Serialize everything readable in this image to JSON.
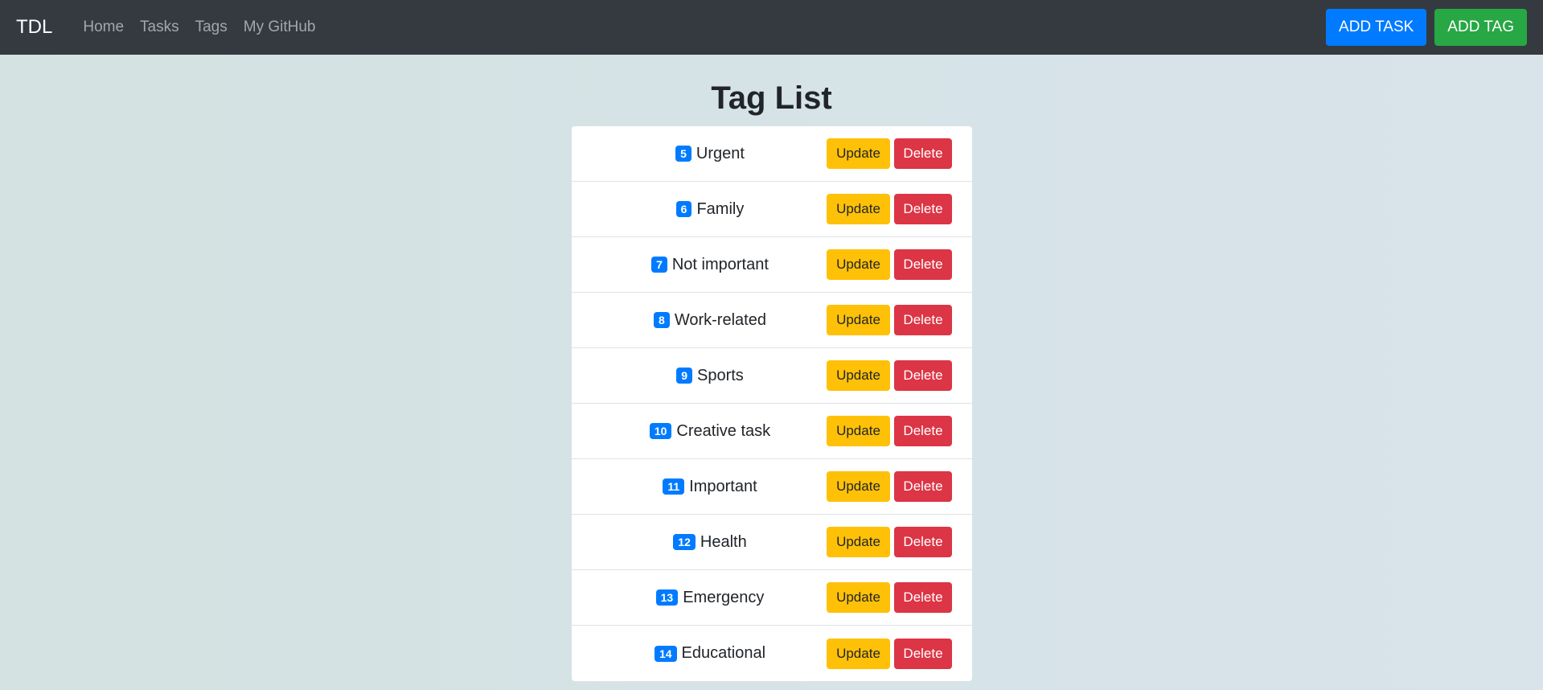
{
  "navbar": {
    "brand": "TDL",
    "links": [
      {
        "label": "Home"
      },
      {
        "label": "Tasks"
      },
      {
        "label": "Tags"
      },
      {
        "label": "My GitHub"
      }
    ],
    "add_task_label": "ADD TASK",
    "add_tag_label": "ADD TAG"
  },
  "main": {
    "title": "Tag List",
    "tags": [
      {
        "id": "5",
        "name": "Urgent",
        "update_label": "Update",
        "delete_label": "Delete"
      },
      {
        "id": "6",
        "name": "Family",
        "update_label": "Update",
        "delete_label": "Delete"
      },
      {
        "id": "7",
        "name": "Not important",
        "update_label": "Update",
        "delete_label": "Delete"
      },
      {
        "id": "8",
        "name": "Work-related",
        "update_label": "Update",
        "delete_label": "Delete"
      },
      {
        "id": "9",
        "name": "Sports",
        "update_label": "Update",
        "delete_label": "Delete"
      },
      {
        "id": "10",
        "name": "Creative task",
        "update_label": "Update",
        "delete_label": "Delete"
      },
      {
        "id": "11",
        "name": "Important",
        "update_label": "Update",
        "delete_label": "Delete"
      },
      {
        "id": "12",
        "name": "Health",
        "update_label": "Update",
        "delete_label": "Delete"
      },
      {
        "id": "13",
        "name": "Emergency",
        "update_label": "Update",
        "delete_label": "Delete"
      },
      {
        "id": "14",
        "name": "Educational",
        "update_label": "Update",
        "delete_label": "Delete"
      }
    ]
  },
  "colors": {
    "navbar_bg": "#343a40",
    "primary": "#007bff",
    "success": "#28a745",
    "warning": "#ffc107",
    "danger": "#dc3545"
  }
}
